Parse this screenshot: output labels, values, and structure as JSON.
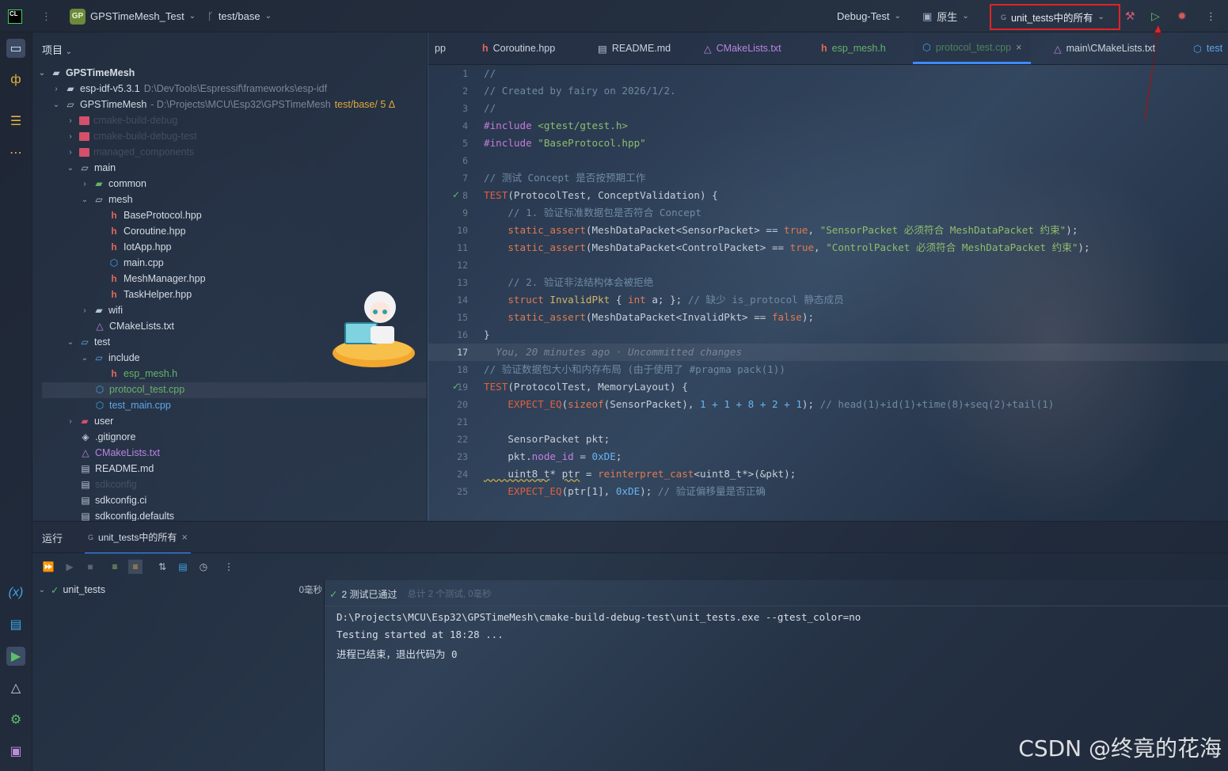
{
  "titlebar": {
    "logo": "CL",
    "project_badge": "GP",
    "project_name": "GPSTimeMesh_Test",
    "branch": "test/base",
    "build_config": "Debug-Test",
    "toolchain": "原生",
    "run_config": "unit_tests中的所有"
  },
  "project_panel": {
    "title": "项目",
    "tree": [
      {
        "label": "GPSTimeMesh",
        "extra": ""
      },
      {
        "label": "esp-idf-v5.3.1",
        "extra": "D:\\DevTools\\Espressif\\frameworks\\esp-idf"
      },
      {
        "label": "GPSTimeMesh",
        "extra": "- D:\\Projects\\MCU\\Esp32\\GPSTimeMesh",
        "branch": "test/base/ 5 Δ"
      },
      {
        "label": "cmake-build-debug"
      },
      {
        "label": "cmake-build-debug-test"
      },
      {
        "label": "managed_components"
      },
      {
        "label": "main"
      },
      {
        "label": "common"
      },
      {
        "label": "mesh"
      },
      {
        "label": "BaseProtocol.hpp"
      },
      {
        "label": "Coroutine.hpp"
      },
      {
        "label": "IotApp.hpp"
      },
      {
        "label": "main.cpp"
      },
      {
        "label": "MeshManager.hpp"
      },
      {
        "label": "TaskHelper.hpp"
      },
      {
        "label": "wifi"
      },
      {
        "label": "CMakeLists.txt"
      },
      {
        "label": "test"
      },
      {
        "label": "include"
      },
      {
        "label": "esp_mesh.h"
      },
      {
        "label": "protocol_test.cpp"
      },
      {
        "label": "test_main.cpp"
      },
      {
        "label": "user"
      },
      {
        "label": ".gitignore"
      },
      {
        "label": "CMakeLists.txt"
      },
      {
        "label": "README.md"
      },
      {
        "label": "sdkconfig"
      },
      {
        "label": "sdkconfig.ci"
      },
      {
        "label": "sdkconfig.defaults"
      }
    ]
  },
  "tabs": [
    {
      "label": "pp"
    },
    {
      "label": "Coroutine.hpp"
    },
    {
      "label": "README.md"
    },
    {
      "label": "CMakeLists.txt"
    },
    {
      "label": "esp_mesh.h"
    },
    {
      "label": "protocol_test.cpp"
    },
    {
      "label": "main\\CMakeLists.txt"
    },
    {
      "label": "test"
    }
  ],
  "editor": {
    "line_numbers": [
      "1",
      "2",
      "3",
      "4",
      "5",
      "6",
      "7",
      "8",
      "9",
      "10",
      "11",
      "12",
      "13",
      "14",
      "15",
      "16",
      "17",
      "18",
      "19",
      "20",
      "21",
      "22",
      "23",
      "24",
      "25"
    ],
    "lines": {
      "l1": "//",
      "l2": "// Created by fairy on 2026/1/2.",
      "l3": "//",
      "l4a": "#include ",
      "l4b": "<gtest/gtest.h>",
      "l5a": "#include ",
      "l5b": "\"BaseProtocol.hpp\"",
      "l7": "// 测试 Concept 是否按预期工作",
      "l8a": "TEST",
      "l8b": "(ProtocolTest, ConceptValidation) {",
      "l9": "    // 1. 验证标准数据包是否符合 Concept",
      "l10a": "    static_assert",
      "l10b": "(MeshDataPacket<SensorPacket> == ",
      "l10c": "true",
      "l10d": ", ",
      "l10e": "\"SensorPacket 必须符合 MeshDataPacket 约束\"",
      "l10f": ");",
      "l11a": "    static_assert",
      "l11b": "(MeshDataPacket<ControlPacket> == ",
      "l11c": "true",
      "l11d": ", ",
      "l11e": "\"ControlPacket 必须符合 MeshDataPacket 约束\"",
      "l11f": ");",
      "l13": "    // 2. 验证非法结构体会被拒绝",
      "l14a": "    struct ",
      "l14b": "InvalidPkt",
      "l14c": " { ",
      "l14d": "int",
      "l14e": " a; }; ",
      "l14f": "// 缺少 is_protocol 静态成员",
      "l15a": "    static_assert",
      "l15b": "(MeshDataPacket<InvalidPkt> == ",
      "l15c": "false",
      "l15d": ");",
      "l16": "}",
      "l17": "  You, 20 minutes ago · Uncommitted changes",
      "l18": "// 验证数据包大小和内存布局 (由于使用了 #pragma pack(1))",
      "l19a": "TEST",
      "l19b": "(ProtocolTest, MemoryLayout) {",
      "l20a": "    EXPECT_EQ",
      "l20b": "(",
      "l20c": "sizeof",
      "l20d": "(SensorPacket), ",
      "l20e": "1 + 1 + 8 + 2 + 1",
      "l20f": "); ",
      "l20g": "// head(1)+id(1)+time(8)+seq(2)+tail(1)",
      "l22": "    SensorPacket pkt;",
      "l23a": "    pkt.",
      "l23b": "node_id",
      "l23c": " = ",
      "l23d": "0xDE",
      "l23e": ";",
      "l24a": "    uint8_t",
      "l24b": "* ",
      "l24c": "ptr",
      "l24d": " = ",
      "l24e": "reinterpret_cast",
      "l24f": "<uint8_t*>(&pkt);",
      "l25a": "    EXPECT_EQ",
      "l25b": "(ptr[1], ",
      "l25c": "0xDE",
      "l25d": "); ",
      "l25e": "// 验证偏移量是否正确"
    }
  },
  "run_panel": {
    "tab_run": "运行",
    "tab_config": "unit_tests中的所有",
    "tree_root": "unit_tests",
    "tree_time": "0毫秒",
    "status": "2 测试已通过",
    "status_extra": "总计 2 个测试, 0毫秒",
    "console": [
      "D:\\Projects\\MCU\\Esp32\\GPSTimeMesh\\cmake-build-debug-test\\unit_tests.exe --gtest_color=no",
      "Testing started at 18:28 ...",
      "进程已结束，退出代码为 0"
    ]
  },
  "watermark": "CSDN @终竟的花海",
  "colors": {
    "accent": "#3d8bff",
    "highlight_box": "#e02424",
    "pass_green": "#5cbf6a"
  }
}
